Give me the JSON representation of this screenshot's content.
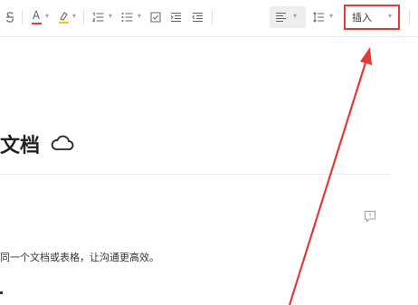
{
  "toolbar": {
    "items": [
      {
        "name": "strikethrough-icon"
      },
      {
        "name": "font-color-icon",
        "glyph": "A",
        "underline_color": "#e53935"
      },
      {
        "name": "highlight-icon",
        "underline_color": "#f5c518"
      },
      {
        "name": "numbered-list-icon"
      },
      {
        "name": "bullet-list-icon"
      },
      {
        "name": "checklist-icon"
      },
      {
        "name": "indent-increase-icon"
      },
      {
        "name": "indent-decrease-icon"
      },
      {
        "name": "align-icon"
      },
      {
        "name": "line-spacing-icon"
      }
    ],
    "insert_label": "插入"
  },
  "document": {
    "title": "文档",
    "body_text": "同一个文档或表格，让沟通更高效。"
  },
  "colors": {
    "highlight_box": "#e53935",
    "arrow": "#e53935"
  }
}
